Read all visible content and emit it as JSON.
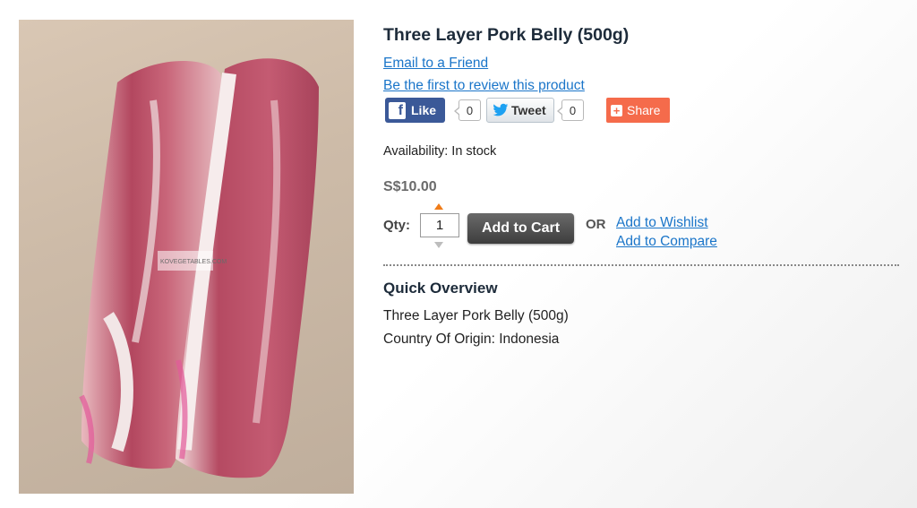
{
  "product": {
    "title": "Three Layer Pork Belly (500g)",
    "email_link": "Email to a Friend",
    "review_link": "Be the first to review this product",
    "availability": "Availability: In stock",
    "price": "S$10.00",
    "image_watermark": "KOVEGETABLES.COM"
  },
  "social": {
    "like_label": "Like",
    "like_count": "0",
    "tweet_label": "Tweet",
    "tweet_count": "0",
    "share_label": "Share"
  },
  "cart": {
    "qty_label": "Qty:",
    "qty_value": "1",
    "add_to_cart": "Add to Cart",
    "or_label": "OR",
    "wishlist": "Add to Wishlist",
    "compare": "Add to Compare"
  },
  "overview": {
    "title": "Quick Overview",
    "lines": [
      "Three Layer Pork Belly (500g)",
      "Country Of Origin: Indonesia"
    ]
  },
  "colors": {
    "link": "#1a75c9",
    "facebook": "#3b5998",
    "share": "#f56b4b",
    "qty_arrow": "#f07c18"
  },
  "icons": [
    "facebook-icon",
    "twitter-bird-icon",
    "share-plus-icon",
    "arrow-up-icon",
    "arrow-down-icon"
  ]
}
